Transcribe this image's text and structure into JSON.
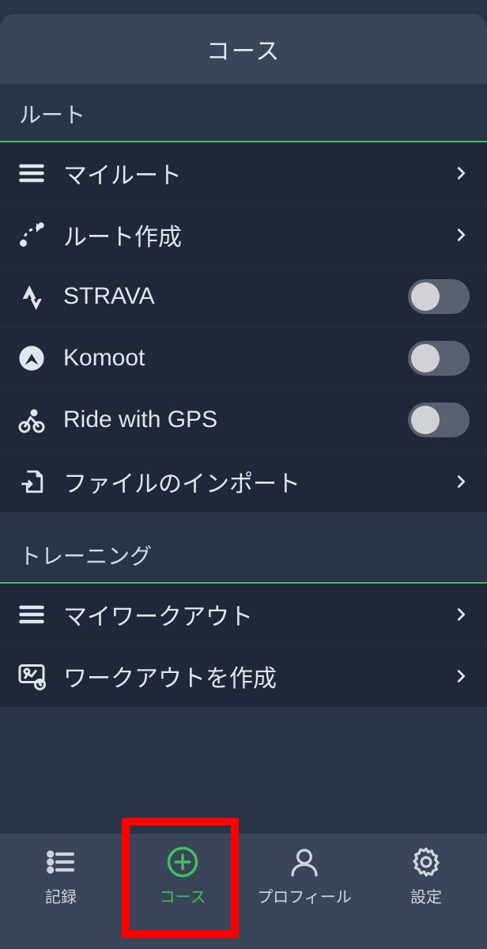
{
  "header": {
    "title": "コース"
  },
  "sections": {
    "routes": {
      "title": "ルート",
      "items": {
        "my_routes": "マイルート",
        "create_route": "ルート作成",
        "strava": "STRAVA",
        "komoot": "Komoot",
        "ride_with_gps": "Ride with GPS",
        "import_file": "ファイルのインポート"
      }
    },
    "training": {
      "title": "トレーニング",
      "items": {
        "my_workouts": "マイワークアウト",
        "create_workout": "ワークアウトを作成"
      }
    }
  },
  "toggles": {
    "strava": false,
    "komoot": false,
    "ride_with_gps": false
  },
  "tabs": {
    "record": "記録",
    "course": "コース",
    "profile": "プロフィール",
    "settings": "設定"
  },
  "colors": {
    "accent": "#3fbf5e",
    "bg_dark": "#1f2738",
    "bg_mid": "#2a3448",
    "bg_light": "#3a4559"
  }
}
